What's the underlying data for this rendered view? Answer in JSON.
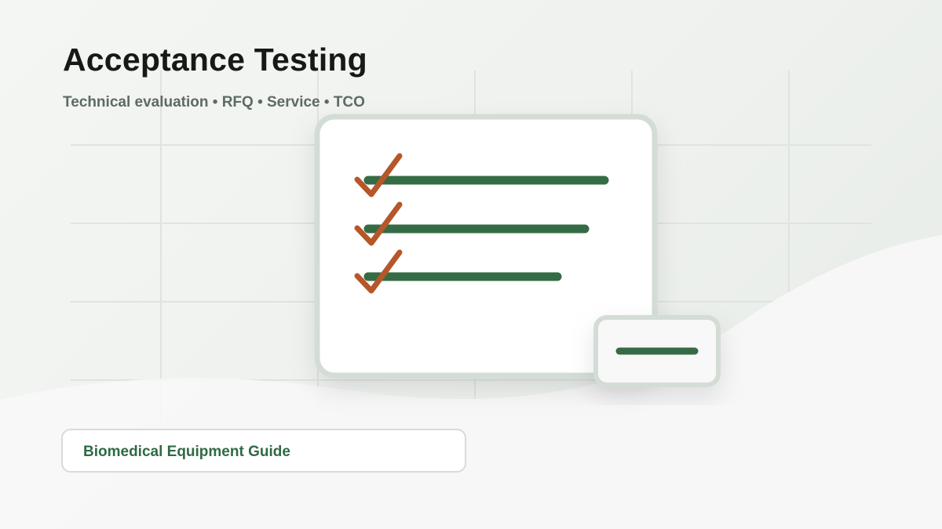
{
  "header": {
    "title": "Acceptance Testing",
    "subtitle": "Technical evaluation • RFQ • Service • TCO"
  },
  "badge": {
    "label": "Biomedical Equipment Guide"
  },
  "illustration": {
    "checklist_items": 3
  },
  "colors": {
    "accent_green": "#356b45",
    "check_orange": "#b5572a",
    "title_text": "#161a17",
    "subtitle_text": "#5d6b62",
    "card_border": "#d3ddd6"
  },
  "icons": [
    "checkmark-icon",
    "checklist-card-icon",
    "minus-card-icon"
  ]
}
